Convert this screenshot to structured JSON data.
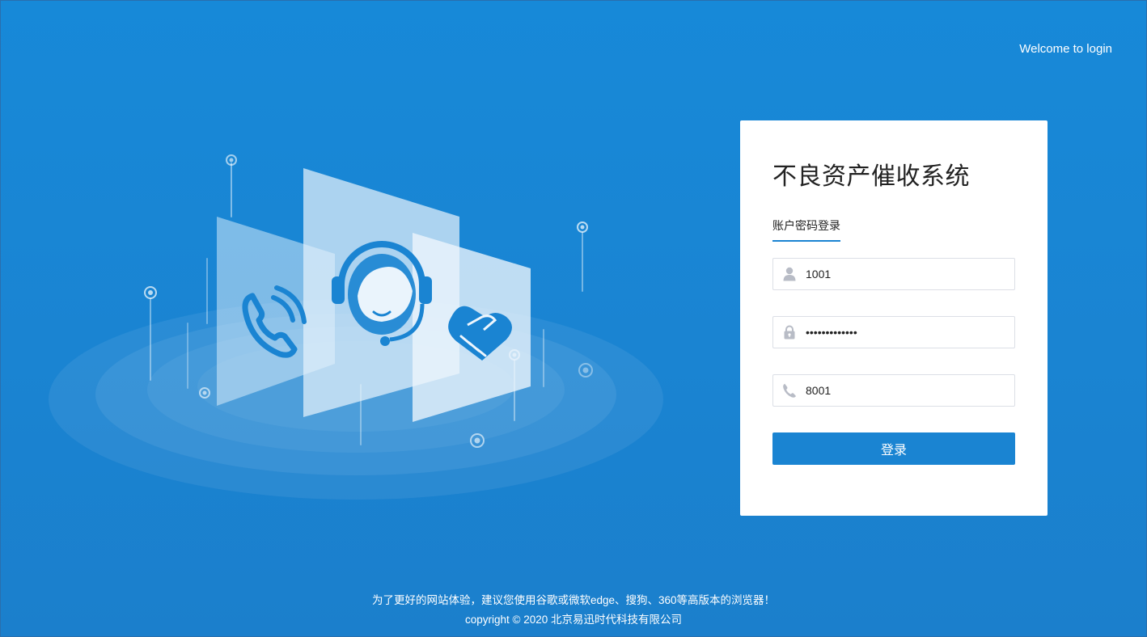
{
  "header": {
    "welcome_text": "Welcome to login"
  },
  "login_card": {
    "title": "不良资产催收系统",
    "tab_label": "账户密码登录",
    "username": {
      "value": "1001",
      "icon": "user-icon"
    },
    "password": {
      "value": "•••••••••••••",
      "icon": "lock-icon"
    },
    "phone": {
      "value": "8001",
      "icon": "phone-icon"
    },
    "login_button_label": "登录"
  },
  "illustration": {
    "panel_icons": [
      "phone-ringing-icon",
      "customer-service-headset-icon",
      "handshake-icon"
    ]
  },
  "footer": {
    "browser_tip": "为了更好的网站体验，建议您使用谷歌或微软edge、搜狗、360等高版本的浏览器！",
    "copyright": "copyright © 2020 北京易迅时代科技有限公司"
  },
  "colors": {
    "background": "#1789d8",
    "accent": "#1a84d2",
    "card": "#ffffff"
  }
}
